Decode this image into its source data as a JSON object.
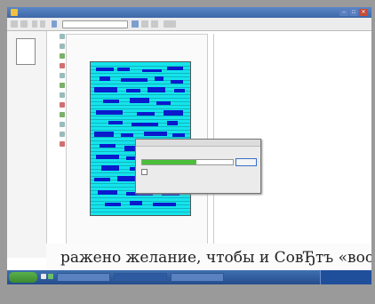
{
  "window": {
    "title": "",
    "minimize_glyph": "–",
    "maximize_glyph": "□",
    "close_glyph": "✕"
  },
  "toolbar": {
    "zoom_value": ""
  },
  "dialog": {
    "title": "",
    "message": "",
    "button_label": "",
    "checkbox_label": "",
    "progress": 0.6
  },
  "document": {
    "page_label": "",
    "right_pane_text": ""
  },
  "book_text": {
    "line1": "ражено желание, чтобы и СовЂтъ «воодушевленъ б",
    "line2": ""
  },
  "taskbar": {
    "start_label": "",
    "clock": ""
  },
  "colors": {
    "page_background": "#15e4ec",
    "highlight_blocks": "#0a1acc",
    "progress_fill": "#4bbf3a",
    "taskbar": "#244d8c"
  }
}
